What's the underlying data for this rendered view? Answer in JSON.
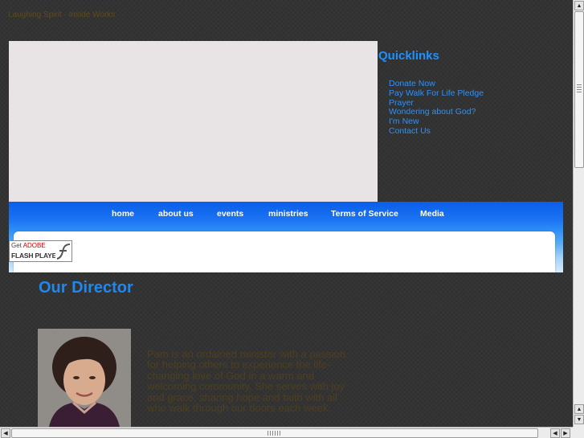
{
  "header": {
    "top_note": "Laughing Spirit · Inside Works"
  },
  "quicklinks": {
    "title": "Quicklinks",
    "items": [
      "Donate Now",
      "Pay Walk For Life Pledge",
      "Prayer",
      "Wondering about God?",
      "I'm New",
      "Contact Us"
    ]
  },
  "nav": {
    "items": [
      "home",
      "about us",
      "events",
      "ministries",
      "Terms of Service",
      "Media"
    ]
  },
  "flash_badge": {
    "get": "Get",
    "adobe": "ADOBE",
    "player": "FLASH PLAYER"
  },
  "director": {
    "title": "Our Director",
    "bio": "Pam is an ordained minister with a passion for helping others to experience the life-changing love of God in a warm and welcoming community. She serves with joy and grace, sharing hope and faith with all who walk through our doors each week."
  },
  "colors": {
    "background": "#333333",
    "accent": "#1e88ee",
    "link": "#2a92ff",
    "muted_text": "#4e3f1d"
  },
  "icons": {
    "scroll_up": "triangle-up-icon",
    "scroll_down": "triangle-down-icon",
    "scroll_left": "triangle-left-icon",
    "scroll_right": "triangle-right-icon",
    "flash": "flash-logo-icon"
  }
}
